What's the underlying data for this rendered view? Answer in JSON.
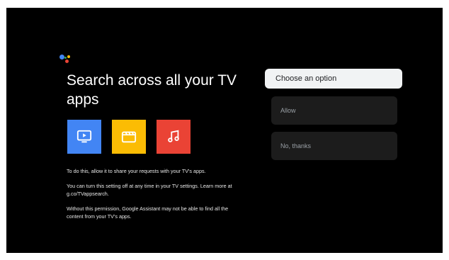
{
  "title": "Search across all your TV apps",
  "apps": [
    {
      "icon": "tv-play-icon",
      "color": "#4285f4"
    },
    {
      "icon": "clapperboard-icon",
      "color": "#fbbc04"
    },
    {
      "icon": "music-note-icon",
      "color": "#ea4335"
    }
  ],
  "info": {
    "line1": "To do this, allow it to share your requests with your TV's apps.",
    "line2": "You can turn this setting off at any time in your TV settings. Learn more at g.co/TVappsearch.",
    "line3": "Without this permission, Google Assistant may not be able to find all the content from your TV's apps."
  },
  "options": {
    "header": "Choose an option",
    "allow": "Allow",
    "decline": "No, thanks"
  },
  "colors": {
    "background": "#000000",
    "google_blue": "#4285f4",
    "google_red": "#ea4335",
    "google_yellow": "#fbbc04",
    "google_green": "#34a853"
  }
}
